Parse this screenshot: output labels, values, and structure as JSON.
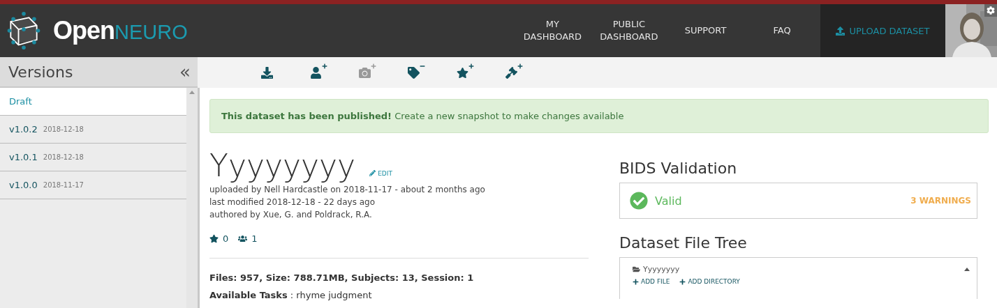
{
  "header": {
    "logo": {
      "word_1": "Open",
      "word_2": "NEURO"
    },
    "nav": [
      {
        "label": "MY DASHBOARD"
      },
      {
        "label": "PUBLIC DASHBOARD"
      },
      {
        "label": "SUPPORT"
      },
      {
        "label": "FAQ"
      }
    ],
    "upload": {
      "label": "UPLOAD DATASET"
    }
  },
  "sidebar": {
    "title": "Versions",
    "collapse": "«",
    "items": [
      {
        "name": "Draft",
        "selected": true
      },
      {
        "name": "v1.0.2",
        "date": "2018-12-18",
        "selected": false
      },
      {
        "name": "v1.0.1",
        "date": "2018-12-18",
        "selected": false
      },
      {
        "name": "v1.0.0",
        "date": "2018-11-17",
        "selected": false
      }
    ]
  },
  "toolbar": {
    "tools": [
      {
        "kind": "download",
        "disabled": false
      },
      {
        "kind": "user",
        "disabled": false
      },
      {
        "kind": "camera",
        "disabled": true
      },
      {
        "kind": "tag",
        "disabled": false
      },
      {
        "kind": "star",
        "disabled": false
      },
      {
        "kind": "gavel",
        "disabled": false
      }
    ]
  },
  "alert": {
    "text": "**This dataset has been published!** Create a new snapshot to make changes available"
  },
  "dataset": {
    "title": "Yyyyyyyy",
    "edit": "EDIT",
    "meta": [
      "uploaded by Nell Hardcastle on 2018-11-17 - about 2 months ago",
      "last modified 2018-12-18 - 22 days ago",
      "authored by Xue, G. and Poldrack, R.A."
    ],
    "stars": "0",
    "followers": "1",
    "summary": "Files: 957, Size: 788.71MB, Subjects: 13, Session: 1",
    "tasks_label": "Available Tasks",
    "tasks": ": rhyme judgment"
  },
  "validation": {
    "title": "BIDS Validation",
    "status": "Valid",
    "warnings": "3 WARNINGS"
  },
  "file_tree": {
    "title": "Dataset File Tree",
    "root": "Yyyyyyyy",
    "expanded": true,
    "add_file": "ADD FILE",
    "add_directory": "ADD DIRECTORY"
  }
}
